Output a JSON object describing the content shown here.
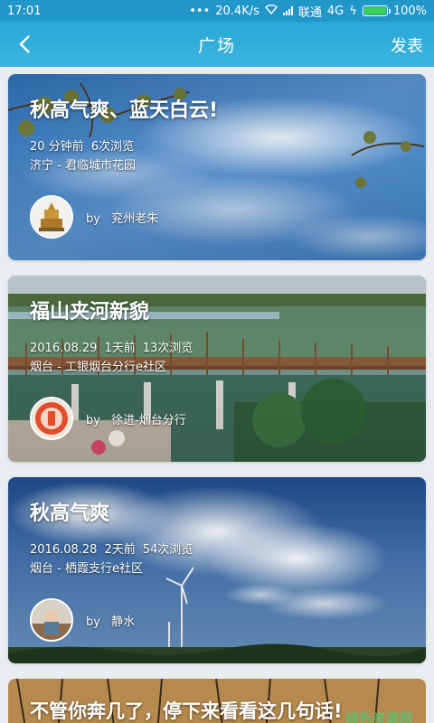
{
  "status": {
    "time": "17:01",
    "speed": "20.4K/s",
    "carrier": "联通",
    "network": "4G",
    "battery": "100%"
  },
  "header": {
    "title": "广场",
    "action": "发表"
  },
  "posts": [
    {
      "title": "秋高气爽、蓝天白云!",
      "time": "20 分钟前",
      "views": "6次浏览",
      "location": "济宁 - 君临城市花园",
      "by": "by",
      "author": "兖州老朱"
    },
    {
      "title": "福山夹河新貌",
      "date": "2016.08.29",
      "time": "1天前",
      "views": "13次浏览",
      "location": "烟台 - 工银烟台分行e社区",
      "by": "by",
      "author": "徐进-烟台分行"
    },
    {
      "title": "秋高气爽",
      "date": "2016.08.28",
      "time": "2天前",
      "views": "54次浏览",
      "location": "烟台 - 栖霞支行e社区",
      "by": "by",
      "author": "静水"
    },
    {
      "title": "不管你奔几了，停下来看看这几句话!"
    }
  ],
  "watermark": "绿色资源网",
  "colors": {
    "status_bar": "#2196c9",
    "app_bar": "#2aa6d6",
    "background": "#e9edf0"
  }
}
